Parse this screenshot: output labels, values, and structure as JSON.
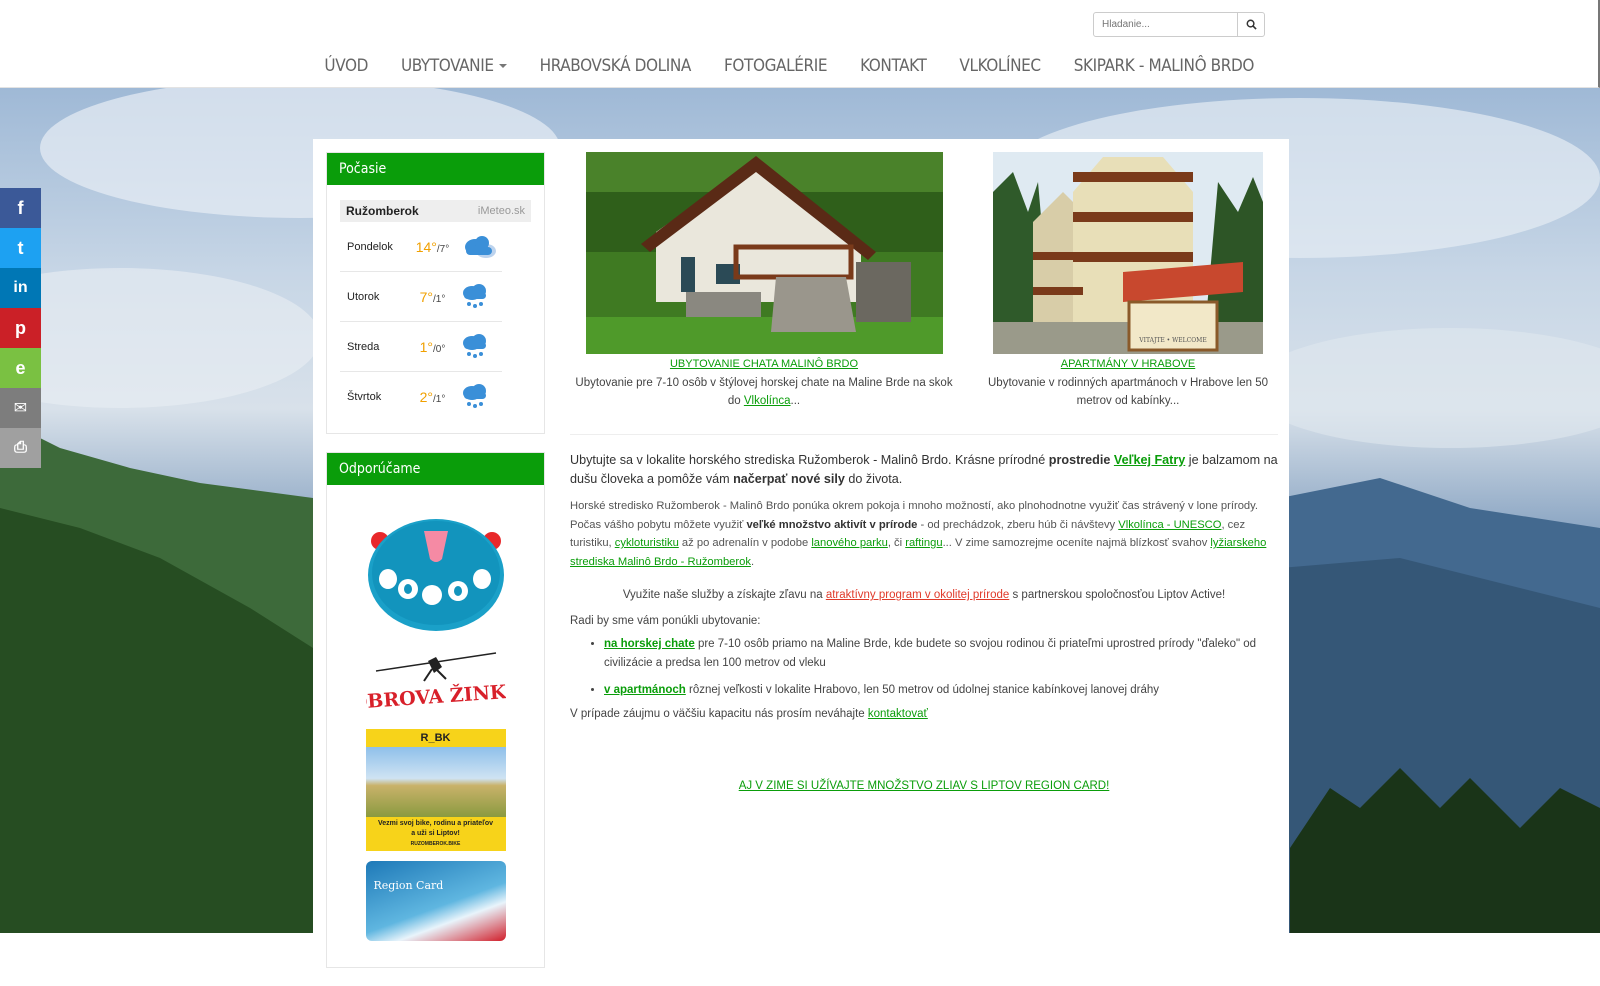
{
  "search": {
    "placeholder": "Hladanie..."
  },
  "nav": {
    "items": [
      {
        "label": "ÚVOD"
      },
      {
        "label": "UBYTOVANIE"
      },
      {
        "label": "HRABOVSKÁ DOLINA"
      },
      {
        "label": "FOTOGALÉRIE"
      },
      {
        "label": "KONTAKT"
      },
      {
        "label": "VLKOLÍNEC"
      },
      {
        "label": "SKIPARK - MALINÔ BRDO"
      }
    ]
  },
  "share": {
    "items": [
      {
        "icon": "facebook-icon",
        "glyph": "f",
        "color": "#3b5998"
      },
      {
        "icon": "twitter-icon",
        "glyph": "t",
        "color": "#1da1f2"
      },
      {
        "icon": "linkedin-icon",
        "glyph": "in",
        "color": "#0077b5"
      },
      {
        "icon": "pinterest-icon",
        "glyph": "p",
        "color": "#cb2027"
      },
      {
        "icon": "evernote-icon",
        "glyph": "e",
        "color": "#7ac142"
      },
      {
        "icon": "email-icon",
        "glyph": "✉",
        "color": "#7d7d7d"
      },
      {
        "icon": "print-icon",
        "glyph": "⎙",
        "color": "#a0a0a0"
      }
    ]
  },
  "weather": {
    "title": "Počasie",
    "city": "Ružomberok",
    "source": "iMeteo.sk",
    "days": [
      {
        "day": "Pondelok",
        "hi": "14°",
        "lo": "/7°"
      },
      {
        "day": "Utorok",
        "hi": "7°",
        "lo": "/1°"
      },
      {
        "day": "Streda",
        "hi": "1°",
        "lo": "/0°"
      },
      {
        "day": "Štvrtok",
        "hi": "2°",
        "lo": "/1°"
      }
    ]
  },
  "recommend": {
    "title": "Odporúčame",
    "banner3_title": "R_BK",
    "banner3_line1": "Vezmi svoj bike, rodinu a priateľov",
    "banner3_line2": "a uži si Liptov!",
    "banner3_site": "RUZOMBEROK.BIKE",
    "banner4_title": "Region Card",
    "logo2_text": "OBROVA ŽINKA"
  },
  "teasers": {
    "left": {
      "caption": "UBYTOVANIE CHATA MALINÔ BRDO",
      "text_before": "Ubytovanie pre 7-10 osôb v štýlovej horskej chate na Maline Brde na skok do ",
      "link": "Vlkolínca",
      "text_after": "..."
    },
    "right": {
      "caption": "APARTMÁNY V HRABOVE",
      "text": "Ubytovanie v rodinných apartmánoch v Hrabove len 50 metrov od kabínky...",
      "sign": "VITAJTE • WELCOME"
    }
  },
  "intro": {
    "t1": "Ubytujte sa v lokalite horského strediska Ružomberok - Malinô Brdo. Krásne prírodné ",
    "b1": "prostredie",
    "link": "Veľkej Fatry",
    "t2": " je balzamom na dušu človeka a pomôže vám ",
    "b2": "načerpať nové sily",
    "t3": " do života."
  },
  "para": {
    "t1": "Horské stredisko Ružomberok - Malinô Brdo ponúka okrem pokoja i mnoho možností, ako plnohodnotne využiť čas strávený v lone prírody. Počas vášho pobytu môžete využiť ",
    "b1": "veľké množstvo aktivít v prírode",
    "t2": " - od prechádzok, zberu húb či návštevy ",
    "l1": "Vlkolínca - UNESCO",
    "t3": ", cez turistiku, ",
    "l2": "cykloturistiku",
    "t4": " až po adrenalín v podobe ",
    "l3": "lanového parku",
    "t5": ", či ",
    "l4": "raftingu",
    "t6": "... V zime samozrejme oceníte najmä blízkosť svahov ",
    "l5": "lyžiarskeho strediska Malinô Brdo - Ružomberok",
    "t7": "."
  },
  "promo": {
    "t1": "Využite naše služby a získajte zľavu na ",
    "link": "atraktívny program v okolitej prírode",
    "t2": " s partnerskou spoločnosťou Liptov Active!"
  },
  "offer": {
    "intro": "Radi by sme vám ponúkli ubytovanie:",
    "items": [
      {
        "link": "na horskej chate",
        "text": " pre 7-10 osôb priamo na Maline Brde, kde budete so svojou rodinou či priateľmi uprostred prírody \"ďaleko\" od civilizácie a predsa len 100 metrov od vleku"
      },
      {
        "link": "v apartmánoch",
        "text": " rôznej veľkosti v lokalite Hrabovo, len 50 metrov od údolnej stanice kabínkovej lanovej dráhy"
      }
    ],
    "contact_text": "V prípade záujmu o väčšiu kapacitu nás prosím neváhajte ",
    "contact_link": "kontaktovať"
  },
  "region_card_link": "AJ V ZIME SI UŽÍVAJTE MNOŽSTVO ZLIAV S LIPTOV REGION CARD!"
}
